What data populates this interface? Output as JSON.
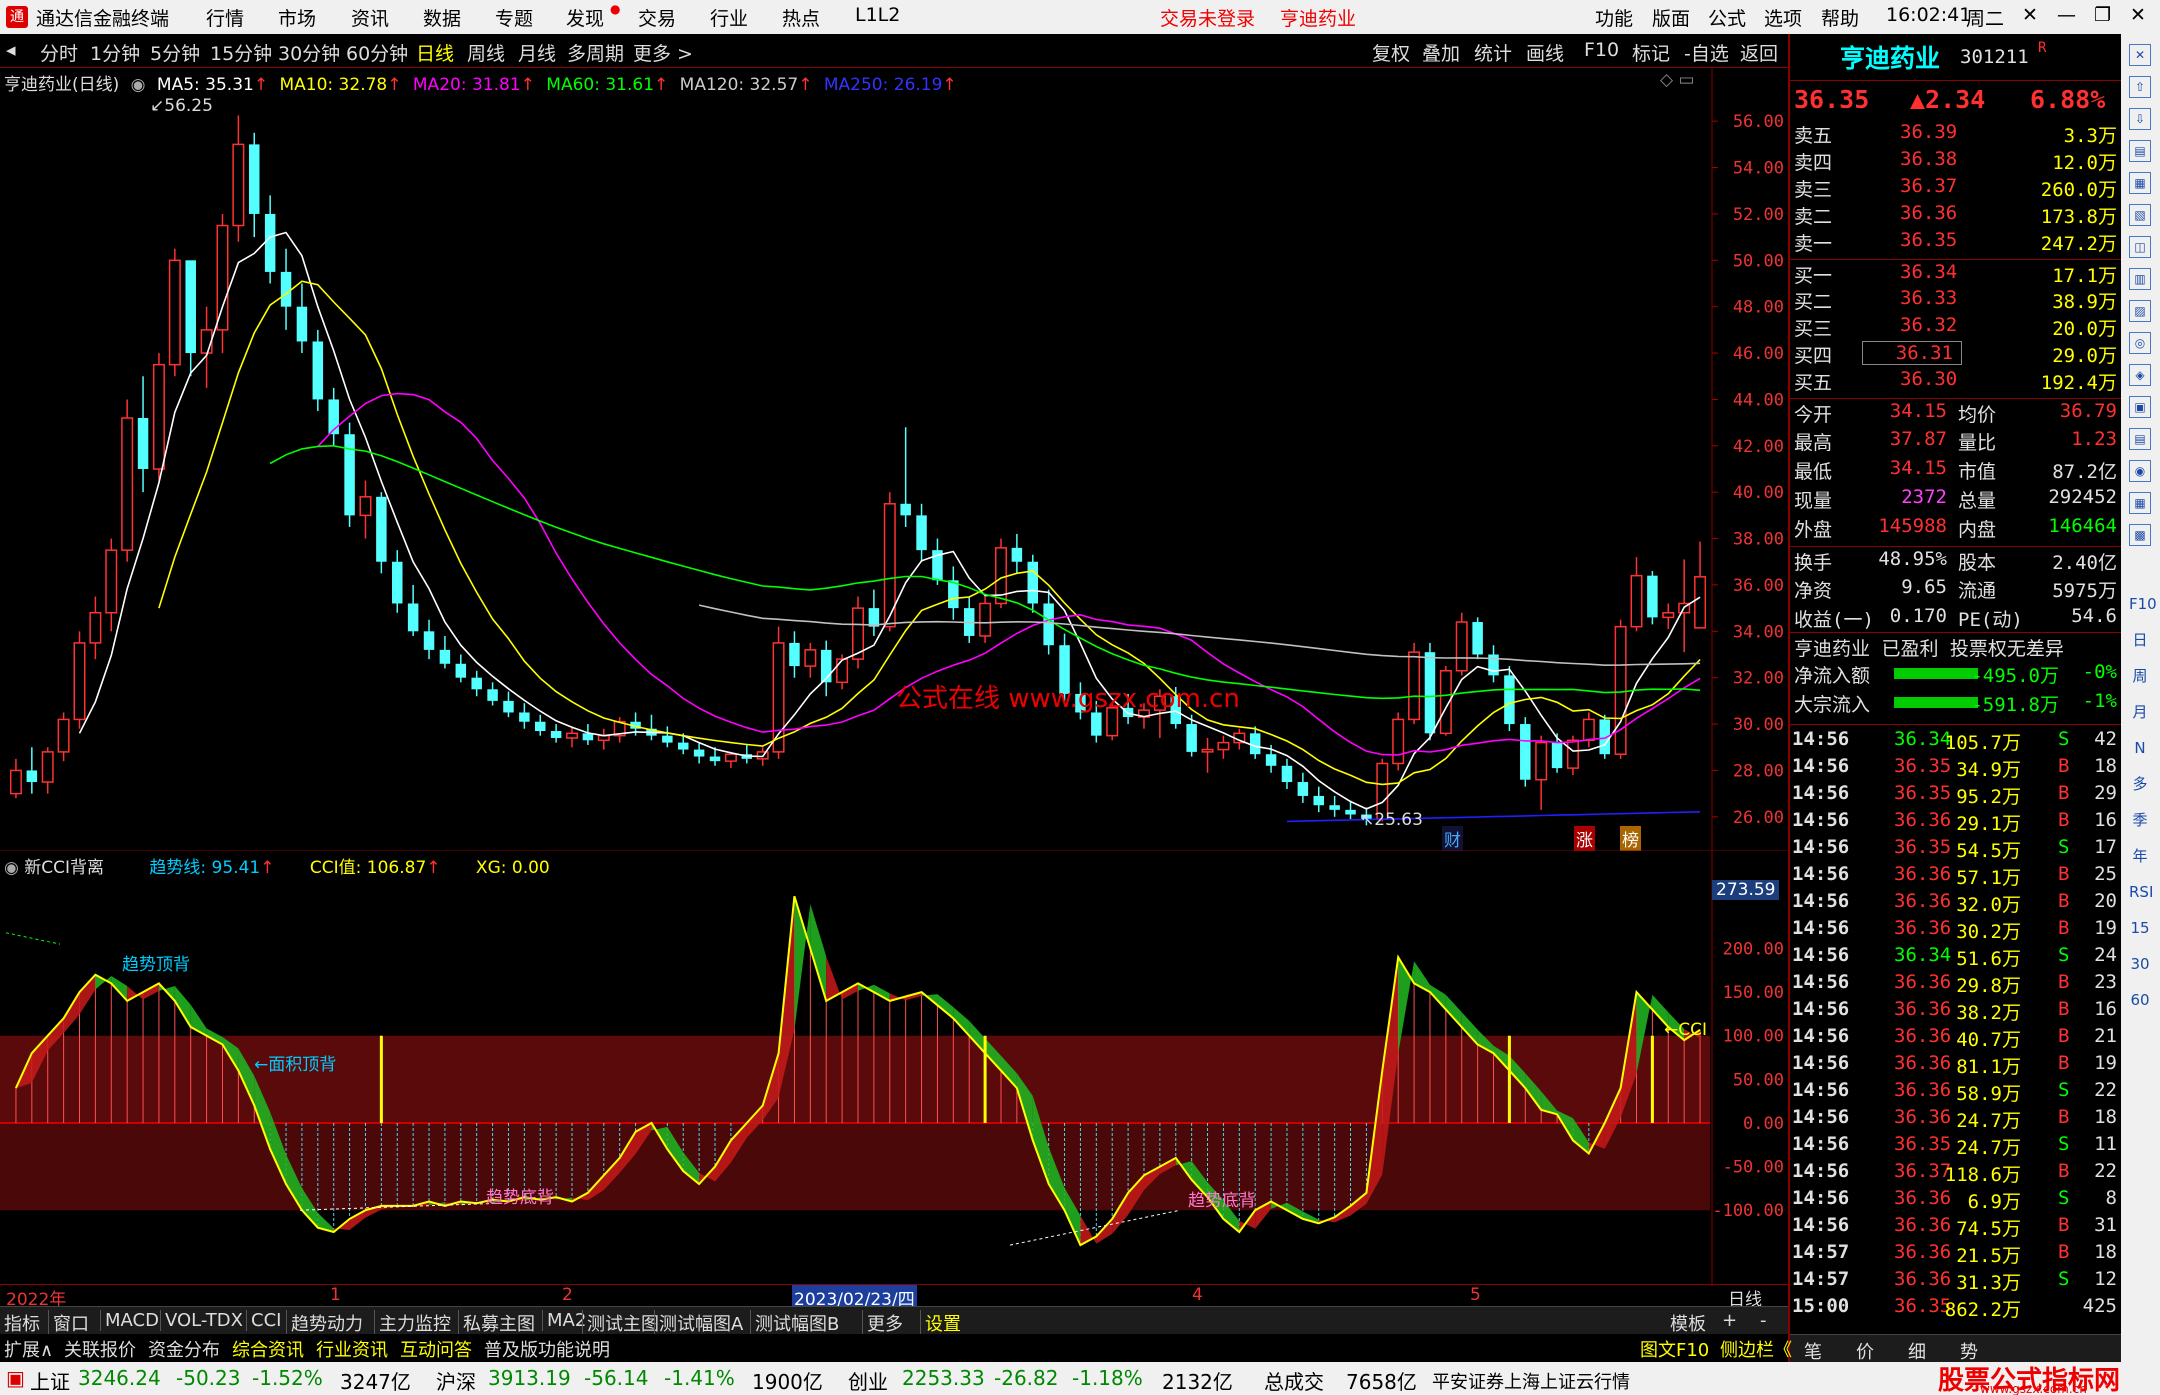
{
  "menubar": {
    "app_title": "通达信金融终端",
    "menus": [
      "行情",
      "市场",
      "资讯",
      "数据",
      "专题",
      "发现",
      "交易",
      "行业",
      "热点",
      "L1L2"
    ],
    "trade_status": "交易未登录",
    "stock_name": "亨迪药业",
    "right_menus": [
      "功能",
      "版面",
      "公式",
      "选项",
      "帮助"
    ],
    "time": "16:02:41",
    "weekday": "周二"
  },
  "toolbar": {
    "periods": [
      "分时",
      "1分钟",
      "5分钟",
      "15分钟",
      "30分钟",
      "60分钟",
      "日线",
      "周线",
      "月线",
      "多周期",
      "更多 >"
    ],
    "active": "日线",
    "right_buttons": [
      "复权",
      "叠加",
      "统计",
      "画线",
      "F10",
      "标记",
      "-自选",
      "返回"
    ]
  },
  "main_legend": {
    "title": "亨迪药业(日线)",
    "ma5": "MA5: 35.31",
    "ma10": "MA10: 32.78",
    "ma20": "MA20: 31.81",
    "ma60": "MA60: 31.61",
    "ma120": "MA120: 32.57",
    "ma250": "MA250: 26.19",
    "high_label": "56.25",
    "low_label": "25.63",
    "watermark": "公式在线 www.gszx.com.cn",
    "markers": [
      "财",
      "涨",
      "榜"
    ]
  },
  "price_axis": [
    "56.00",
    "54.00",
    "52.00",
    "50.00",
    "48.00",
    "46.00",
    "44.00",
    "42.00",
    "40.00",
    "38.00",
    "36.00",
    "34.00",
    "32.00",
    "30.00",
    "28.00",
    "26.00"
  ],
  "sub_legend": {
    "title": "新CCI背离",
    "trend": "趋势线: 95.41",
    "cci": "CCI值: 106.87",
    "xg": "XG: 0.00",
    "ann_top": "趋势顶背",
    "ann_area": "←面积顶背",
    "ann_bottom1": "趋势底背",
    "ann_bottom2": "趋势底背",
    "cci_tag": "←CCI",
    "axis_top": "273.59"
  },
  "cci_axis": [
    "200.00",
    "150.00",
    "100.00",
    "50.00",
    "0.00",
    "-50.00",
    "-100.00"
  ],
  "date_axis": [
    "2022年",
    "1",
    "2",
    "2023/02/23/四",
    "4",
    "5",
    "日线"
  ],
  "tabs1": [
    "指标",
    "窗口",
    "MACD",
    "VOL-TDX",
    "CCI",
    "趋势动力",
    "主力监控",
    "私募主图",
    "MA2",
    "测试主图",
    "测试幅图A",
    "测试幅图B",
    "更多",
    "设置",
    "模板",
    "+",
    "-"
  ],
  "tabs2": [
    "扩展∧",
    "关联报价",
    "资金分布",
    "综合资讯",
    "行业资讯",
    "互动问答",
    "普及版功能说明"
  ],
  "quote": {
    "name": "亨迪药业",
    "code": "301211",
    "price": "36.35",
    "change": "▲2.34",
    "pct": "6.88%",
    "asks": [
      {
        "label": "卖五",
        "price": "36.39",
        "vol": "3.3万"
      },
      {
        "label": "卖四",
        "price": "36.38",
        "vol": "12.0万"
      },
      {
        "label": "卖三",
        "price": "36.37",
        "vol": "260.0万"
      },
      {
        "label": "卖二",
        "price": "36.36",
        "vol": "173.8万"
      },
      {
        "label": "卖一",
        "price": "36.35",
        "vol": "247.2万"
      }
    ],
    "bids": [
      {
        "label": "买一",
        "price": "36.34",
        "vol": "17.1万"
      },
      {
        "label": "买二",
        "price": "36.33",
        "vol": "38.9万"
      },
      {
        "label": "买三",
        "price": "36.32",
        "vol": "20.0万"
      },
      {
        "label": "买四",
        "price": "36.31",
        "vol": "29.0万"
      },
      {
        "label": "买五",
        "price": "36.30",
        "vol": "192.4万"
      }
    ],
    "stats": [
      [
        "今开",
        "34.15",
        "均价",
        "36.79"
      ],
      [
        "最高",
        "37.87",
        "量比",
        "1.23"
      ],
      [
        "最低",
        "34.15",
        "市值",
        "87.2亿"
      ],
      [
        "现量",
        "2372",
        "总量",
        "292452"
      ],
      [
        "外盘",
        "145988",
        "内盘",
        "146464"
      ]
    ],
    "stats2": [
      [
        "换手",
        "48.95%",
        "股本",
        "2.40亿"
      ],
      [
        "净资",
        "9.65",
        "流通",
        "5975万"
      ],
      [
        "收益(一)",
        "0.170",
        "PE(动)",
        "54.6"
      ]
    ],
    "info_line": "亨迪药业 已盈利 投票权无差异",
    "flow": [
      {
        "label": "净流入额",
        "value": "-495.0万",
        "pct": "-0%"
      },
      {
        "label": "大宗流入",
        "value": "-591.8万",
        "pct": "-1%"
      }
    ],
    "ticks": [
      [
        "14:56",
        "36.34",
        "105.7万",
        "S",
        "42"
      ],
      [
        "14:56",
        "36.35",
        "34.9万",
        "B",
        "18"
      ],
      [
        "14:56",
        "36.35",
        "95.2万",
        "B",
        "29"
      ],
      [
        "14:56",
        "36.36",
        "29.1万",
        "B",
        "16"
      ],
      [
        "14:56",
        "36.35",
        "54.5万",
        "S",
        "17"
      ],
      [
        "14:56",
        "36.36",
        "57.1万",
        "B",
        "25"
      ],
      [
        "14:56",
        "36.36",
        "32.0万",
        "B",
        "20"
      ],
      [
        "14:56",
        "36.36",
        "30.2万",
        "B",
        "19"
      ],
      [
        "14:56",
        "36.34",
        "51.6万",
        "S",
        "24"
      ],
      [
        "14:56",
        "36.36",
        "29.8万",
        "B",
        "23"
      ],
      [
        "14:56",
        "36.36",
        "38.2万",
        "B",
        "16"
      ],
      [
        "14:56",
        "36.36",
        "40.7万",
        "B",
        "21"
      ],
      [
        "14:56",
        "36.36",
        "81.1万",
        "B",
        "19"
      ],
      [
        "14:56",
        "36.36",
        "58.9万",
        "S",
        "22"
      ],
      [
        "14:56",
        "36.36",
        "24.7万",
        "B",
        "18"
      ],
      [
        "14:56",
        "36.35",
        "24.7万",
        "S",
        "11"
      ],
      [
        "14:56",
        "36.37",
        "118.6万",
        "B",
        "22"
      ],
      [
        "14:56",
        "36.36",
        "6.9万",
        "S",
        "8"
      ],
      [
        "14:56",
        "36.36",
        "74.5万",
        "B",
        "31"
      ],
      [
        "14:57",
        "36.36",
        "21.5万",
        "B",
        "18"
      ],
      [
        "14:57",
        "36.36",
        "31.3万",
        "S",
        "12"
      ],
      [
        "15:00",
        "36.35",
        "862.2万",
        "",
        "425"
      ]
    ],
    "bottom_tabs": [
      "笔",
      "价",
      "细",
      "势"
    ]
  },
  "right_icons": [
    "F10",
    "日",
    "周",
    "月",
    "N",
    "多",
    "季",
    "年",
    "RSI",
    "15",
    "30",
    "60"
  ],
  "statusbar": {
    "sh_name": "上证",
    "sh_val": "3246.24",
    "sh_chg": "-50.23",
    "sh_pct": "-1.52%",
    "sh_amt": "3247亿",
    "hs_name": "沪深",
    "hs_val": "3913.19",
    "hs_chg": "-56.14",
    "hs_pct": "-1.41%",
    "hs_amt": "1900亿",
    "cy_name": "创业",
    "cy_val": "2253.33",
    "cy_chg": "-26.82",
    "cy_pct": "-1.18%",
    "cy_amt": "2132亿",
    "total_label": "总成交",
    "total_val": "7658亿",
    "server": "平安证券上海上证云行情",
    "f10": "图文F10",
    "sidebar": "侧边栏《",
    "logo": "股票公式指标网",
    "logo_url": "www.gszx.com.cn"
  },
  "chart_data": {
    "type": "candlestick",
    "title": "亨迪药业(日线)",
    "ylim": [
      25,
      57
    ],
    "candles": [
      [
        27,
        28.5,
        26.8,
        28
      ],
      [
        28,
        29,
        27,
        27.5
      ],
      [
        27.5,
        29,
        27,
        28.8
      ],
      [
        28.8,
        30.5,
        28.4,
        30.2
      ],
      [
        30.2,
        34,
        29.8,
        33.5
      ],
      [
        33.5,
        35.5,
        32.8,
        34.8
      ],
      [
        34.8,
        38,
        34,
        37.5
      ],
      [
        37.5,
        44,
        37,
        43.2
      ],
      [
        43.2,
        45,
        40,
        41
      ],
      [
        41,
        46,
        40.5,
        45.5
      ],
      [
        45.5,
        50.5,
        45,
        50
      ],
      [
        50,
        49.8,
        45,
        46
      ],
      [
        46,
        48,
        44.5,
        47
      ],
      [
        47,
        52,
        46,
        51.5
      ],
      [
        51.5,
        56.25,
        50.8,
        55
      ],
      [
        55,
        55.5,
        51,
        52
      ],
      [
        52,
        52.8,
        49,
        49.5
      ],
      [
        49.5,
        50.5,
        47,
        48
      ],
      [
        48,
        49,
        46,
        46.5
      ],
      [
        46.5,
        47,
        43.5,
        44
      ],
      [
        44,
        44.5,
        42,
        42.5
      ],
      [
        42.5,
        43,
        38.5,
        39
      ],
      [
        39,
        40.5,
        38,
        39.8
      ],
      [
        39.8,
        40,
        36.5,
        37
      ],
      [
        37,
        37.5,
        34.8,
        35.2
      ],
      [
        35.2,
        36,
        33.8,
        34
      ],
      [
        34,
        34.5,
        32.8,
        33.2
      ],
      [
        33.2,
        33.8,
        32.4,
        32.6
      ],
      [
        32.6,
        33,
        31.8,
        32
      ],
      [
        32,
        32.3,
        31.2,
        31.5
      ],
      [
        31.5,
        31.8,
        30.8,
        31
      ],
      [
        31,
        31.4,
        30.3,
        30.5
      ],
      [
        30.5,
        30.9,
        29.8,
        30.1
      ],
      [
        30.1,
        30.4,
        29.5,
        29.7
      ],
      [
        29.7,
        30,
        29.2,
        29.4
      ],
      [
        29.4,
        29.9,
        29,
        29.6
      ],
      [
        29.6,
        30,
        29.1,
        29.3
      ],
      [
        29.3,
        29.8,
        28.9,
        29.5
      ],
      [
        29.5,
        30.3,
        29.2,
        30.1
      ],
      [
        30.1,
        30.5,
        29.5,
        29.8
      ],
      [
        29.8,
        30.4,
        29.3,
        29.5
      ],
      [
        29.5,
        29.9,
        29,
        29.2
      ],
      [
        29.2,
        29.6,
        28.7,
        28.9
      ],
      [
        28.9,
        29.2,
        28.3,
        28.6
      ],
      [
        28.6,
        29,
        28.2,
        28.4
      ],
      [
        28.4,
        28.8,
        28.1,
        28.7
      ],
      [
        28.7,
        29.1,
        28.3,
        28.5
      ],
      [
        28.5,
        29,
        28.2,
        28.8
      ],
      [
        28.8,
        34.2,
        28.5,
        33.5
      ],
      [
        33.5,
        34,
        32,
        32.5
      ],
      [
        32.5,
        33.5,
        32,
        33.2
      ],
      [
        33.2,
        33.6,
        31.2,
        31.8
      ],
      [
        31.8,
        33,
        31.5,
        32.8
      ],
      [
        32.8,
        35.5,
        32.4,
        35
      ],
      [
        35,
        35.8,
        33.8,
        34.2
      ],
      [
        34.2,
        40,
        34,
        39.5
      ],
      [
        39.5,
        42.8,
        38.5,
        39
      ],
      [
        39,
        39.5,
        37,
        37.5
      ],
      [
        37.5,
        38,
        36,
        36.2
      ],
      [
        36.2,
        36.8,
        34.5,
        35
      ],
      [
        35,
        35.5,
        33.5,
        33.8
      ],
      [
        33.8,
        35.5,
        33.5,
        35.2
      ],
      [
        35.2,
        38,
        35,
        37.6
      ],
      [
        37.6,
        38.2,
        36.5,
        37
      ],
      [
        37,
        37.3,
        34.8,
        35.2
      ],
      [
        35.2,
        35.8,
        33,
        33.4
      ],
      [
        33.4,
        33.9,
        31,
        31.3
      ],
      [
        31.3,
        31.8,
        30.2,
        30.5
      ],
      [
        30.5,
        31,
        29.2,
        29.5
      ],
      [
        29.5,
        30.9,
        29.3,
        30.7
      ],
      [
        30.7,
        31.3,
        30,
        30.3
      ],
      [
        30.3,
        30.9,
        29.8,
        30.6
      ],
      [
        30.6,
        31.5,
        29.4,
        31.2
      ],
      [
        31.2,
        31.6,
        29.8,
        30
      ],
      [
        30,
        30.4,
        28.6,
        28.8
      ],
      [
        28.8,
        29.4,
        27.9,
        28.9
      ],
      [
        28.9,
        29.5,
        28.5,
        29.2
      ],
      [
        29.2,
        29.8,
        28.9,
        29.6
      ],
      [
        29.6,
        29.9,
        28.5,
        28.7
      ],
      [
        28.7,
        29.1,
        27.9,
        28.2
      ],
      [
        28.2,
        28.5,
        27.2,
        27.5
      ],
      [
        27.5,
        27.9,
        26.6,
        26.9
      ],
      [
        26.9,
        27.3,
        26.2,
        26.5
      ],
      [
        26.5,
        26.9,
        26,
        26.3
      ],
      [
        26.3,
        26.7,
        25.9,
        26.1
      ],
      [
        26.1,
        26.4,
        25.63,
        25.9
      ],
      [
        25.9,
        28.5,
        25.8,
        28.3
      ],
      [
        28.3,
        30.5,
        28,
        30.2
      ],
      [
        30.2,
        33.5,
        30,
        33.1
      ],
      [
        33.1,
        33.5,
        29.3,
        29.6
      ],
      [
        29.6,
        32.5,
        29.5,
        32.3
      ],
      [
        32.3,
        34.8,
        32.1,
        34.4
      ],
      [
        34.4,
        34.6,
        32.8,
        33
      ],
      [
        33,
        33.4,
        31.8,
        32.1
      ],
      [
        32.1,
        32.5,
        29.7,
        30
      ],
      [
        30,
        30.3,
        27.3,
        27.6
      ],
      [
        27.6,
        29.5,
        26.3,
        29.2
      ],
      [
        29.2,
        29.6,
        27.9,
        28.1
      ],
      [
        28.1,
        29.5,
        27.8,
        29.3
      ],
      [
        29.3,
        30.5,
        29,
        30.2
      ],
      [
        30.2,
        30.4,
        28.5,
        28.7
      ],
      [
        28.7,
        34.5,
        28.5,
        34.2
      ],
      [
        34.2,
        37.2,
        34,
        36.4
      ],
      [
        36.4,
        36.6,
        34.3,
        34.6
      ],
      [
        34.6,
        35.2,
        34.1,
        34.8
      ],
      [
        34.8,
        37.1,
        33.1,
        35.2
      ],
      [
        34.15,
        37.87,
        34.15,
        36.35
      ]
    ],
    "ma": [
      {
        "name": "MA5",
        "color": "#ffffff"
      },
      {
        "name": "MA10",
        "color": "#ffff00"
      },
      {
        "name": "MA20",
        "color": "#ff00ff"
      },
      {
        "name": "MA60",
        "color": "#00ff00"
      },
      {
        "name": "MA120",
        "color": "#c0c0c0"
      },
      {
        "name": "MA250",
        "color": "#2020ff"
      }
    ],
    "cci": {
      "ylim": [
        -180,
        290
      ],
      "values": [
        40,
        80,
        100,
        120,
        150,
        170,
        160,
        140,
        150,
        160,
        140,
        110,
        100,
        90,
        60,
        20,
        -30,
        -70,
        -100,
        -120,
        -125,
        -110,
        -100,
        -95,
        -95,
        -95,
        -90,
        -95,
        -90,
        -92,
        -88,
        -90,
        -85,
        -88,
        -85,
        -90,
        -80,
        -60,
        -40,
        -10,
        0,
        -30,
        -55,
        -70,
        -50,
        -20,
        0,
        20,
        80,
        260,
        200,
        140,
        150,
        160,
        150,
        140,
        145,
        150,
        135,
        120,
        100,
        80,
        60,
        40,
        -20,
        -70,
        -100,
        -140,
        -130,
        -110,
        -80,
        -60,
        -50,
        -40,
        -65,
        -85,
        -110,
        -125,
        -100,
        -90,
        -100,
        -110,
        -115,
        -108,
        -95,
        -80,
        60,
        190,
        160,
        150,
        130,
        110,
        90,
        80,
        60,
        40,
        15,
        10,
        -20,
        -35,
        0,
        40,
        150,
        130,
        110,
        95,
        106.87
      ]
    }
  }
}
